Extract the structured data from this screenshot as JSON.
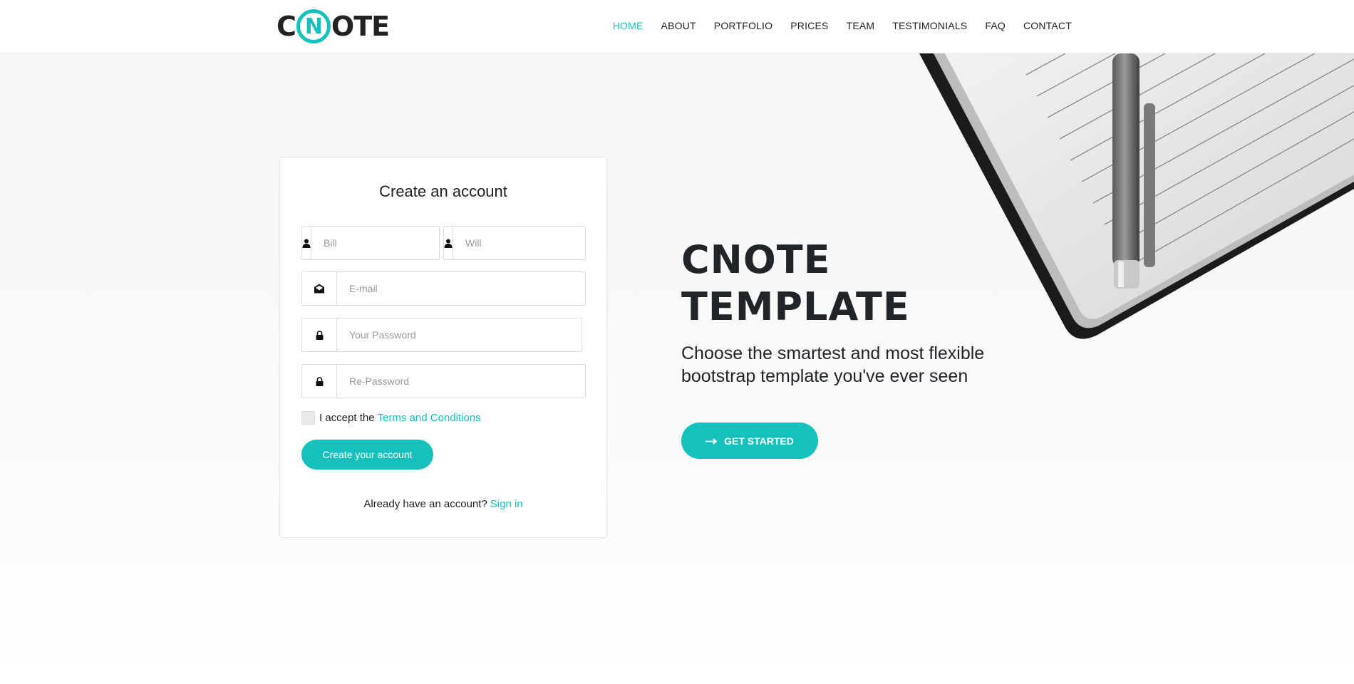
{
  "header": {
    "logo": {
      "before": "C",
      "ring": "N",
      "after": "OTE"
    },
    "nav": [
      "HOME",
      "ABOUT",
      "PORTFOLIO",
      "PRICES",
      "TEAM",
      "TESTIMONIALS",
      "FAQ",
      "CONTACT"
    ],
    "active": "HOME"
  },
  "form": {
    "title": "Create an account",
    "first_name_placeholder": "Bill",
    "last_name_placeholder": "Will",
    "email_placeholder": "E-mail",
    "password_placeholder": "Your Password",
    "repassword_placeholder": "Re-Password",
    "terms_text": "I accept the",
    "terms_link": "Terms and Conditions",
    "submit_label": "Create your account",
    "already_text": "Already have an account?",
    "signin_link": "Sign in",
    "icons": [
      "user-icon",
      "user-icon",
      "envelope-open-icon",
      "lock-icon",
      "lock-icon"
    ]
  },
  "hero": {
    "title_line1": "CNOTE",
    "title_line2": "TEMPLATE",
    "subtitle_line1": "Choose the smartest and most flexible",
    "subtitle_line2": "bootstrap template you've ever seen",
    "cta_label": "GET STARTED",
    "cta_icon": "arrow-right-icon"
  },
  "colors": {
    "accent": "#16c1bd",
    "text": "#212529"
  }
}
